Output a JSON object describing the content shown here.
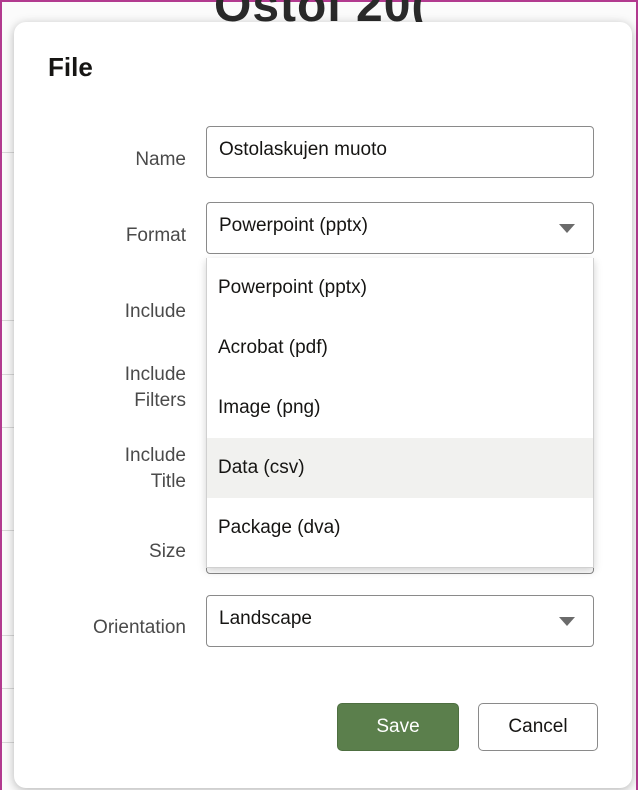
{
  "background": {
    "partial_text": "Ostol 20("
  },
  "dialog": {
    "title": "File",
    "labels": {
      "name": "Name",
      "format": "Format",
      "include": "Include",
      "include_filters_1": "Include",
      "include_filters_2": "Filters",
      "include_title_1": "Include",
      "include_title_2": "Title",
      "size": "Size",
      "orientation": "Orientation"
    },
    "name_value": "Ostolaskujen muoto",
    "format_value": "Powerpoint (pptx)",
    "orientation_value": "Landscape",
    "format_options": [
      "Powerpoint (pptx)",
      "Acrobat (pdf)",
      "Image (png)",
      "Data (csv)",
      "Package (dva)"
    ],
    "highlighted_option": "Data (csv)",
    "buttons": {
      "save": "Save",
      "cancel": "Cancel"
    }
  },
  "colors": {
    "save_button": "#5b7f4c",
    "highlight_row": "#f1f1ef",
    "frame_accent": "#b23a8f"
  }
}
